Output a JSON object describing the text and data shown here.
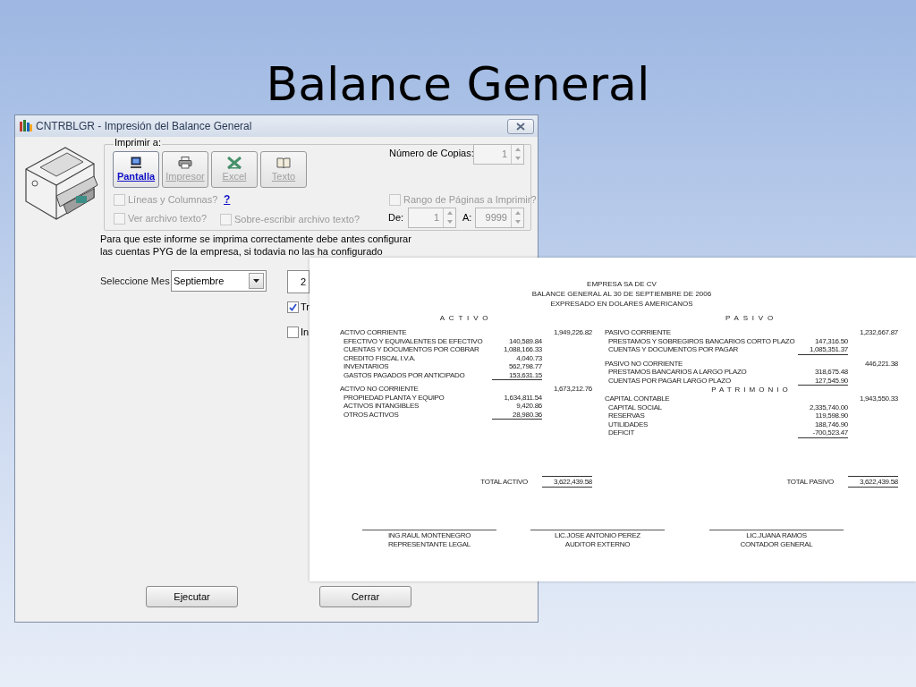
{
  "slide": {
    "title": "Balance General"
  },
  "dialog": {
    "title": "CNTRBLGR - Impresión del Balance General",
    "group_label": "Imprimir a:",
    "output_buttons": [
      {
        "kind": "screen",
        "label": "Pantalla",
        "selected": true,
        "disabled": false
      },
      {
        "kind": "printer",
        "label": "Impresor",
        "selected": false,
        "disabled": true
      },
      {
        "kind": "excel",
        "label": "Excel",
        "selected": false,
        "disabled": true
      },
      {
        "kind": "text",
        "label": "Texto",
        "selected": false,
        "disabled": true
      }
    ],
    "options": [
      {
        "label": "Líneas y Columnas?",
        "checked": false,
        "disabled": true
      },
      {
        "label": "Ver archivo texto?",
        "checked": false,
        "disabled": true
      },
      {
        "label": "Sobre-escribir archivo texto?",
        "checked": false,
        "disabled": true
      }
    ],
    "help_link": "?",
    "copies": {
      "label": "Número de Copias:",
      "value": "1"
    },
    "page_range": {
      "label": "Rango de Páginas a Imprimir?",
      "checked": false,
      "disabled": true
    },
    "range_from": {
      "label": "De:",
      "value": "1"
    },
    "range_to": {
      "label": "A:",
      "value": "9999"
    },
    "note_lines": [
      "Para que este informe se imprima correctamente debe antes configurar",
      "las cuentas PYG de la empresa, si todavia no las ha configurado"
    ],
    "month": {
      "label": "Seleccione Mes",
      "value": "Septiembre"
    },
    "year_field": {
      "value": "2"
    },
    "checks": [
      {
        "label": "Tr",
        "checked": true
      },
      {
        "label": "In",
        "checked": false
      }
    ],
    "buttons": [
      "Ejecutar",
      "Cerrar"
    ]
  },
  "report": {
    "header_lines": [
      "EMPRESA SA DE CV",
      "BALANCE GENERAL  AL 30 DE SEPTIEMBRE DE 2006",
      "EXPRESADO EN DOLARES AMERICANOS"
    ],
    "columns": [
      {
        "heading": "ACTIVO",
        "sections": [
          {
            "title": "ACTIVO CORRIENTE",
            "total": "1,949,226.82",
            "items": [
              {
                "label": "EFECTIVO Y EQUIVALENTES DE EFECTIVO",
                "amount": "140,589.84"
              },
              {
                "label": "CUENTAS Y DOCUMENTOS POR COBRAR",
                "amount": "1,088,166.33"
              },
              {
                "label": "CREDITO FISCAL I.V.A.",
                "amount": "4,040.73"
              },
              {
                "label": "INVENTARIOS",
                "amount": "562,798.77"
              },
              {
                "label": "GASTOS PAGADOS POR ANTICIPADO",
                "amount": "153,631.15"
              }
            ]
          },
          {
            "title": "ACTIVO NO CORRIENTE",
            "total": "1,673,212.76",
            "items": [
              {
                "label": "PROPIEDAD PLANTA Y EQUIPO",
                "amount": "1,634,811.54"
              },
              {
                "label": "ACTIVOS INTANGIBLES",
                "amount": "9,420.86"
              },
              {
                "label": "OTROS ACTIVOS",
                "amount": "28,980.36"
              }
            ]
          }
        ],
        "total": {
          "label": "TOTAL ACTIVO",
          "value": "3,622,439.58"
        }
      },
      {
        "heading": "PASIVO",
        "sections": [
          {
            "title": "PASIVO CORRIENTE",
            "total": "1,232,667.87",
            "items": [
              {
                "label": "PRESTAMOS Y SOBREGIROS BANCARIOS CORTO PLAZO",
                "amount": "147,316.50"
              },
              {
                "label": "CUENTAS Y DOCUMENTOS POR PAGAR",
                "amount": "1,085,351.37"
              }
            ]
          },
          {
            "title": "PASIVO NO CORRIENTE",
            "total": "446,221.38",
            "items": [
              {
                "label": "PRESTAMOS BANCARIOS A LARGO PLAZO",
                "amount": "318,675.48"
              },
              {
                "label": "CUENTAS POR PAGAR LARGO PLAZO",
                "amount": "127,545.90"
              }
            ]
          },
          {
            "heading": "PATRIMONIO",
            "title": "CAPITAL CONTABLE",
            "total": "1,943,550.33",
            "items": [
              {
                "label": "CAPITAL SOCIAL",
                "amount": "2,335,740.00"
              },
              {
                "label": "RESERVAS",
                "amount": "119,598.90"
              },
              {
                "label": "UTILIDADES",
                "amount": "188,746.90"
              },
              {
                "label": "DEFICIT",
                "amount": "-700,523.47"
              }
            ]
          }
        ],
        "total": {
          "label": "TOTAL PASIVO",
          "value": "3,622,439.58"
        }
      }
    ],
    "signatures": [
      {
        "name": "ING.RAUL MONTENEGRO",
        "role": "REPRESENTANTE LEGAL"
      },
      {
        "name": "LIC.JOSE ANTONIO PEREZ",
        "role": "AUDITOR EXTERNO"
      },
      {
        "name": "LIC.JUANA RAMOS",
        "role": "CONTADOR GENERAL"
      }
    ]
  }
}
